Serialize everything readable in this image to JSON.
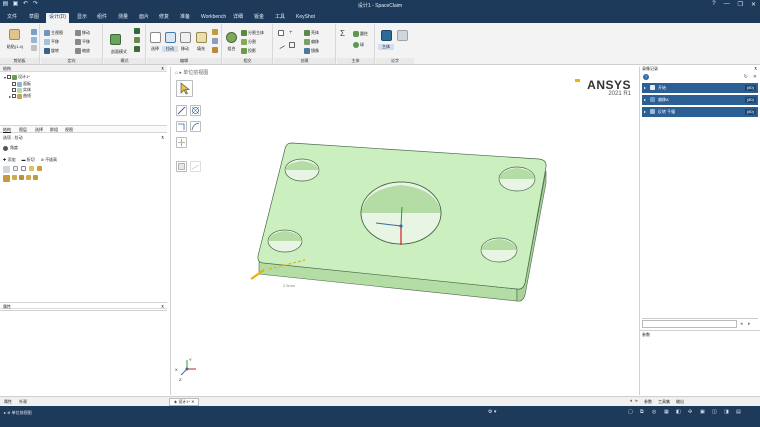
{
  "window": {
    "title": "设计1 - SpaceClaim",
    "quick_access": [
      "▤",
      "▣",
      "↶",
      "↷"
    ],
    "controls": [
      "?",
      "—",
      "❐",
      "✕"
    ]
  },
  "menu": {
    "tabs": [
      "文件",
      "草图",
      "设计(D)",
      "显示",
      "组件",
      "测量",
      "面片",
      "修复",
      "准备",
      "Workbench",
      "详细",
      "钣金",
      "工具",
      "KeyShot"
    ],
    "active_index": 2
  },
  "ribbon": {
    "clipboard": {
      "paste": "粘贴(1.4)",
      "group": "剪贴板"
    },
    "orient": {
      "home": "主视图",
      "plane": "平移",
      "zoom": "旋转",
      "move": "移动",
      "pan": "平移",
      "scale": "缩放",
      "group": "定向"
    },
    "mode": {
      "label": "剖面模式",
      "group": "模式"
    },
    "edit": {
      "select": "选择",
      "pull": "拉动",
      "move": "移动",
      "fill": "填充",
      "group": "编辑"
    },
    "intersect": {
      "combine": "组合",
      "split_body": "分割主体",
      "split": "分割",
      "project": "投影",
      "group": "相交"
    },
    "create": {
      "shell": "壳体",
      "offset": "偏移",
      "mirror": "镜像",
      "group": "创建"
    },
    "body": {
      "cylinder": "圆柱",
      "sphere": "球",
      "group": "主体"
    },
    "assembly": {
      "body": "主体",
      "group": "论字"
    }
  },
  "structure": {
    "title": "结构",
    "items": [
      "设计1*",
      "面板",
      "实体",
      "曲线"
    ]
  },
  "subtabs": {
    "items": [
      "结构",
      "图层",
      "选择",
      "群组",
      "视图"
    ],
    "active_index": 0
  },
  "options": {
    "title": "选项 - 拉动",
    "mode_label": "角度",
    "row1": [
      "添加",
      "折切",
      "不拔高"
    ]
  },
  "properties": {
    "title": "属性",
    "bottom_tabs": [
      "属性",
      "外观"
    ]
  },
  "viewport": {
    "breadcrumb": "⌂ ▸ 单位前视图",
    "brand": "ANSYS",
    "version": "2021 R1",
    "dimension": "2.5mm",
    "axis": {
      "x": "X",
      "y": "Y",
      "z": "Z"
    },
    "colors": {
      "body_face": "#ccefbf",
      "body_side": "#b4dca5",
      "body_edge": "#4a6a4a",
      "hole": "#e8f5e4",
      "hole_inner": "#dff0d9"
    }
  },
  "history": {
    "title": "录像记录",
    "items": [
      {
        "label": "开始",
        "count": "(80)"
      },
      {
        "label": "偏移A",
        "count": "(80)"
      },
      {
        "label": "反转 千幅",
        "count": "(80)"
      }
    ]
  },
  "parameters": {
    "title": "参数",
    "tabs": [
      "参数",
      "工具集",
      "输出"
    ]
  },
  "docbar": {
    "tab": "设计1*"
  },
  "status": {
    "left": "▸ ⊕ 单位前视图"
  }
}
